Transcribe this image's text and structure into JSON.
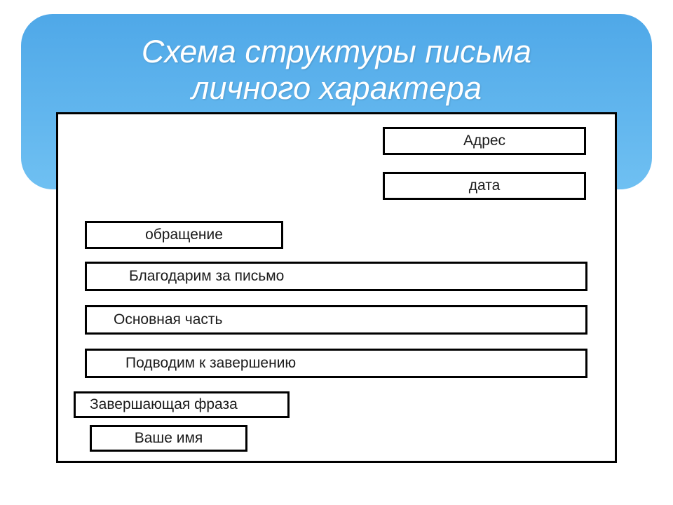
{
  "title_line1": "Схема структуры письма",
  "title_line2": "личного характера",
  "fields": {
    "address": "Адрес",
    "date": "дата",
    "greeting": "обращение",
    "thanks": "Благодарим за письмо",
    "main": "Основная часть",
    "closing": "Подводим к завершению",
    "phrase": "Завершающая фраза",
    "name": "Ваше имя"
  }
}
